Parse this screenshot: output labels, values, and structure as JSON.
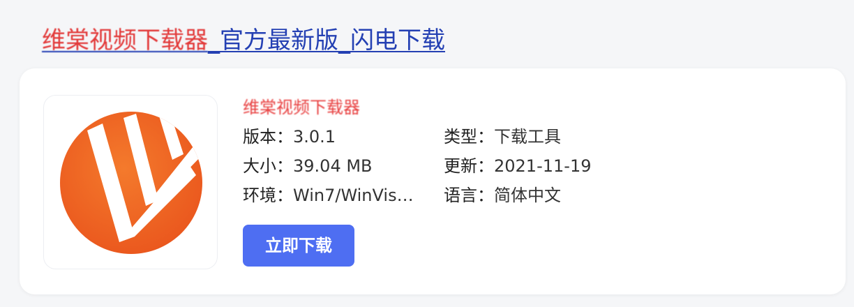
{
  "result": {
    "title_redacted": "维棠视频下载器",
    "title_rest": "_官方最新版_闪电下载"
  },
  "app": {
    "name": "维棠视频下载器",
    "icon": "vidown-logo-icon",
    "version_label": "版本：",
    "version": "3.0.1",
    "type_label": "类型：",
    "type": "下载工具",
    "size_label": "大小：",
    "size": "39.04 MB",
    "updated_label": "更新：",
    "updated": "2021-11-19",
    "env_label": "环境：",
    "env": "Win7/WinVis…",
    "lang_label": "语言：",
    "lang": "简体中文",
    "download_label": "立即下载"
  },
  "colors": {
    "link": "#2440b3",
    "redacted": "#e23a3a",
    "button": "#4e6ef2",
    "logo_orange": "#f26522"
  }
}
